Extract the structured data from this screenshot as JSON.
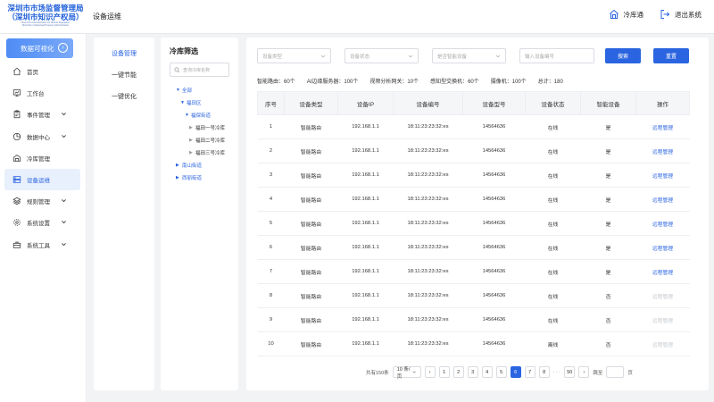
{
  "logo": {
    "line1": "深圳市市场监督管理局",
    "line2": "（深圳市知识产权局）",
    "line3": "Shenzhen Administration for Market Regulation",
    "line4": "Shenzhen Intellectual Property Administration"
  },
  "header": {
    "title": "设备运维",
    "right_items": [
      {
        "label": "冷库通",
        "icon": "home-icon"
      },
      {
        "label": "退出系统",
        "icon": "logout-icon"
      }
    ]
  },
  "sidebar": {
    "top_button": "数据可视化",
    "items": [
      {
        "label": "首页",
        "icon": "home-icon",
        "expand": false
      },
      {
        "label": "工作台",
        "icon": "monitor-icon",
        "expand": false
      },
      {
        "label": "事件管理",
        "icon": "clipboard-icon",
        "expand": true
      },
      {
        "label": "数据中心",
        "icon": "pie-icon",
        "expand": true
      },
      {
        "label": "冷库管理",
        "icon": "warehouse-icon",
        "expand": false
      },
      {
        "label": "设备运维",
        "icon": "server-icon",
        "expand": false,
        "active": true
      },
      {
        "label": "规则管理",
        "icon": "layers-icon",
        "expand": true
      },
      {
        "label": "系统设置",
        "icon": "gear-icon",
        "expand": true
      },
      {
        "label": "系统工具",
        "icon": "toolbox-icon",
        "expand": true
      }
    ]
  },
  "submenu": {
    "items": [
      {
        "label": "设备管理",
        "active": true
      },
      {
        "label": "一键节能",
        "active": false
      },
      {
        "label": "一键优化",
        "active": false
      }
    ]
  },
  "tree": {
    "title": "冷库筛选",
    "search_placeholder": "查询冷库名称",
    "nodes": [
      {
        "label": "全部",
        "level": 0,
        "arrow": "▼",
        "style": "blue"
      },
      {
        "label": "福田区",
        "level": 1,
        "arrow": "▼",
        "style": "blue"
      },
      {
        "label": "福保街道",
        "level": 2,
        "arrow": "▼",
        "style": "blue"
      },
      {
        "label": "福田一号冷库",
        "level": 3,
        "arrow": "▶",
        "style": "grey"
      },
      {
        "label": "福田二号冷库",
        "level": 3,
        "arrow": "▶",
        "style": "grey"
      },
      {
        "label": "福田三号冷库",
        "level": 3,
        "arrow": "▶",
        "style": "grey"
      },
      {
        "label": "南山街道",
        "level": 2,
        "arrow": "▶",
        "style": "blue"
      },
      {
        "label": "西丽街道",
        "level": 2,
        "arrow": "▶",
        "style": "blue"
      }
    ]
  },
  "filters": {
    "selects": [
      "设备类型",
      "设备状态",
      "是否智能设备"
    ],
    "input_placeholder": "输入设备编号",
    "search_label": "搜索",
    "reset_label": "重置"
  },
  "stats": [
    "智能路由：60个",
    "AI边缘服务器：100个",
    "视频分析网关：10个",
    "感知型交换机：60个",
    "摄像机：100个",
    "总计：180"
  ],
  "table": {
    "columns": [
      "序号",
      "设备类型",
      "设备IP",
      "设备编号",
      "设备型号",
      "设备状态",
      "智能设备",
      "操作"
    ],
    "rows": [
      [
        "1",
        "智能路由",
        "192.168.1.1",
        "18:11:23:23:32:es",
        "14564636",
        "在线",
        "是",
        "远程管理",
        true
      ],
      [
        "2",
        "智能路由",
        "192.168.1.1",
        "18:11:23:23:32:es",
        "14564636",
        "在线",
        "是",
        "远程管理",
        true
      ],
      [
        "3",
        "智能路由",
        "192.168.1.1",
        "18:11:23:23:32:es",
        "14564636",
        "在线",
        "是",
        "远程管理",
        true
      ],
      [
        "4",
        "智能路由",
        "192.168.1.1",
        "18:11:23:23:32:es",
        "14564636",
        "在线",
        "是",
        "远程管理",
        true
      ],
      [
        "5",
        "智能路由",
        "192.168.1.1",
        "18:11:23:23:32:es",
        "14564636",
        "在线",
        "是",
        "远程管理",
        true
      ],
      [
        "6",
        "智能路由",
        "192.168.1.1",
        "18:11:23:23:32:es",
        "14564636",
        "在线",
        "是",
        "远程管理",
        true
      ],
      [
        "7",
        "智能路由",
        "192.168.1.1",
        "18:11:23:23:32:es",
        "14564636",
        "在线",
        "是",
        "远程管理",
        true
      ],
      [
        "8",
        "智能路由",
        "192.168.1.1",
        "18:11:23:23:32:es",
        "14564636",
        "在线",
        "否",
        "远程管理",
        false
      ],
      [
        "9",
        "智能路由",
        "192.168.1.1",
        "18:11:23:23:32:es",
        "14564636",
        "在线",
        "否",
        "远程管理",
        false
      ],
      [
        "10",
        "智能路由",
        "192.168.1.1",
        "18:11:23:23:32:es",
        "14564636",
        "离线",
        "否",
        "远程管理",
        false
      ]
    ]
  },
  "pagination": {
    "total_text": "共有150条",
    "page_size": "10 条/页",
    "pages_before": [
      "1",
      "2",
      "3",
      "4",
      "5"
    ],
    "current": "6",
    "pages_after": [
      "7",
      "8"
    ],
    "ellipsis": "···",
    "last": "50",
    "jump_label": "跳至",
    "page_suffix": "页"
  },
  "colors": {
    "primary": "#2a64e0",
    "disabled": "#c6c9cf"
  }
}
